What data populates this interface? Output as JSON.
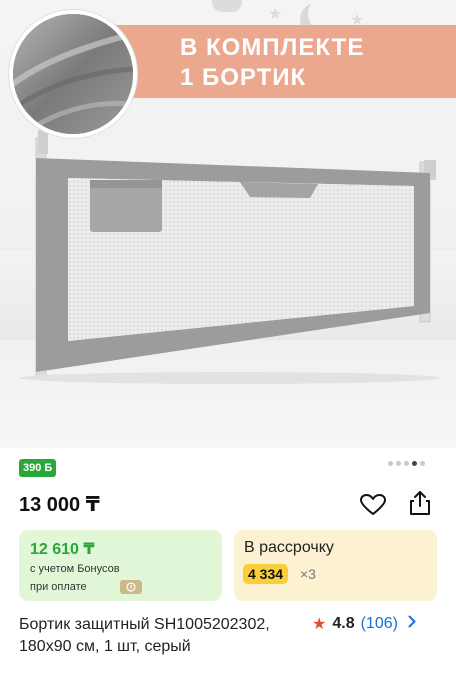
{
  "product_image": {
    "banner_line1": "В КОМПЛЕКТЕ",
    "banner_line2": "1 БОРТИК",
    "banner_color": "#eba88f"
  },
  "gallery": {
    "bonus_badge": "390 Б",
    "dots_total": 5,
    "active_dot": 4
  },
  "price": {
    "main": "13 000 ₸"
  },
  "actions": {
    "favorite_icon": "heart-icon",
    "share_icon": "share-icon"
  },
  "bonus_card": {
    "amount": "12 610 ₸",
    "line1": "с учетом Бонусов",
    "line2": "при оплате",
    "background": "#e2f7d7",
    "accent": "#2aa63a"
  },
  "installment_card": {
    "label": "В рассрочку",
    "amount": "4 334",
    "multiplier": "×3",
    "background": "#fcf2d2",
    "pill_color": "#f8cf3b"
  },
  "product": {
    "title": "Бортик защитный SH1005202302, 180х90 см, 1 шт, серый",
    "rating": "4.8",
    "reviews": "(106)",
    "star_color": "#e24a3a",
    "link_color": "#1d6fd6"
  }
}
